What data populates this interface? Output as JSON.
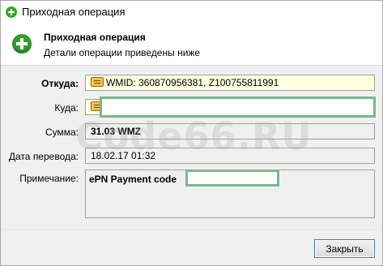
{
  "window": {
    "title": "Приходная операция"
  },
  "header": {
    "title": "Приходная операция",
    "subtitle": "Детали операции приведены ниже"
  },
  "form": {
    "from_label": "Откуда:",
    "from_value": "WMID: 360870956381, Z100755811991",
    "to_label": "Куда:",
    "to_value": "",
    "amount_label": "Сумма:",
    "amount_value": "31.03 WMZ",
    "date_label": "Дата перевода:",
    "date_value": "18.02.17 01:32",
    "note_label": "Примечание:",
    "note_value": "ePN Payment code"
  },
  "buttons": {
    "close_label": "Закрыть"
  },
  "watermark": "Code66.RU"
}
